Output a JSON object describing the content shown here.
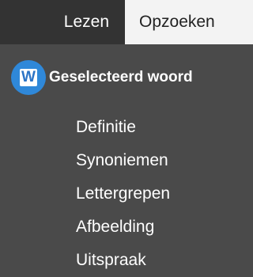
{
  "tabs": {
    "read_label": "Lezen",
    "lookup_label": "Opzoeken"
  },
  "section": {
    "icon_letter": "W",
    "title": "Geselecteerd woord"
  },
  "menu": {
    "items": [
      {
        "label": "Definitie"
      },
      {
        "label": "Synoniemen"
      },
      {
        "label": "Lettergrepen"
      },
      {
        "label": "Afbeelding"
      },
      {
        "label": "Uitspraak"
      }
    ]
  },
  "colors": {
    "panel_bg": "#4a4a4a",
    "tab_read_bg": "#333333",
    "tab_lookup_bg": "#f3f3f3",
    "icon_blue": "#2f88d9"
  }
}
